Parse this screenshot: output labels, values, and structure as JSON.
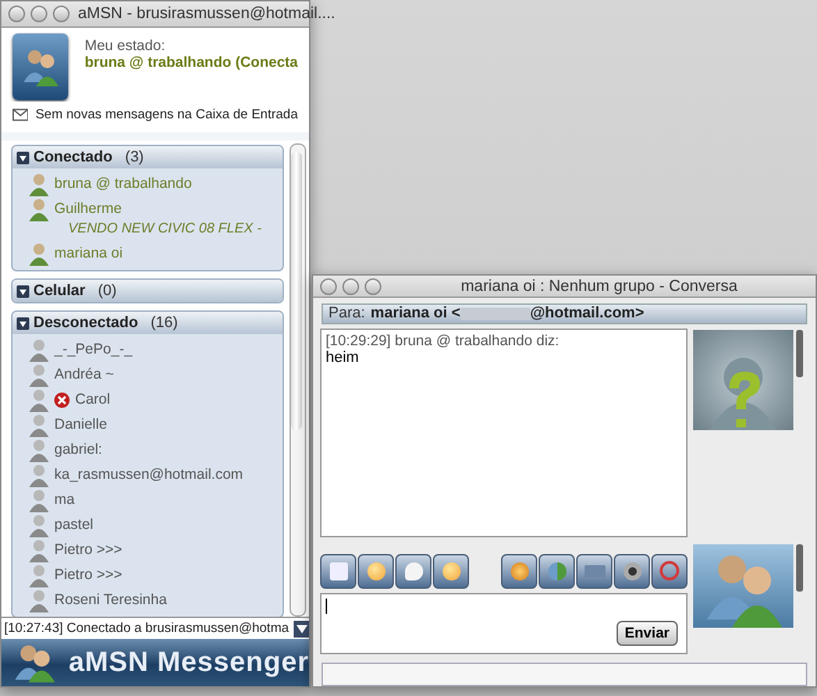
{
  "main_window": {
    "title": "aMSN - brusirasmussen@hotmail....",
    "status_label": "Meu estado:",
    "status_value": "bruna @ trabalhando (Conecta",
    "mail_notice": "Sem novas mensagens na Caixa de Entrada",
    "groups": [
      {
        "name": "Conectado",
        "count": "(3)",
        "expanded": true,
        "contacts": [
          {
            "name": "bruna @ trabalhando",
            "kind": "online",
            "blocked": false
          },
          {
            "name": "Guilherme",
            "kind": "online",
            "blocked": false,
            "personal_message": "VENDO NEW CIVIC 08 FLEX -"
          },
          {
            "name": "mariana oi",
            "kind": "online",
            "blocked": false
          }
        ]
      },
      {
        "name": "Celular",
        "count": "(0)",
        "expanded": true
      },
      {
        "name": "Desconectado",
        "count": "(16)",
        "expanded": true,
        "contacts": [
          {
            "name": "_-_PePo_-_",
            "kind": "offline",
            "blocked": false
          },
          {
            "name": "Andréa  ~",
            "kind": "offline",
            "blocked": false
          },
          {
            "name": "Carol",
            "kind": "offline",
            "blocked": true
          },
          {
            "name": "Danielle",
            "kind": "offline",
            "blocked": false
          },
          {
            "name": "gabriel:",
            "kind": "offline",
            "blocked": false
          },
          {
            "name": "ka_rasmussen@hotmail.com",
            "kind": "offline",
            "blocked": false
          },
          {
            "name": "ma",
            "kind": "offline",
            "blocked": false
          },
          {
            "name": "pastel",
            "kind": "offline",
            "blocked": false
          },
          {
            "name": "Pietro >>>",
            "kind": "offline",
            "blocked": false
          },
          {
            "name": "Pietro >>>",
            "kind": "offline",
            "blocked": false
          },
          {
            "name": "Roseni Teresinha",
            "kind": "offline",
            "blocked": false
          }
        ]
      }
    ],
    "status_bar": "[10:27:43] Conectado a brusirasmussen@hotma",
    "banner": "aMSN Messenger"
  },
  "chat_window": {
    "title": "mariana oi : Nenhum grupo - Conversa",
    "to_label": "Para:",
    "to_before": "mariana oi <",
    "to_after": "@hotmail.com>",
    "messages": [
      {
        "header": "[10:29:29] bruna @ trabalhando diz:",
        "body": "heim"
      }
    ],
    "send_button": "Enviar"
  }
}
